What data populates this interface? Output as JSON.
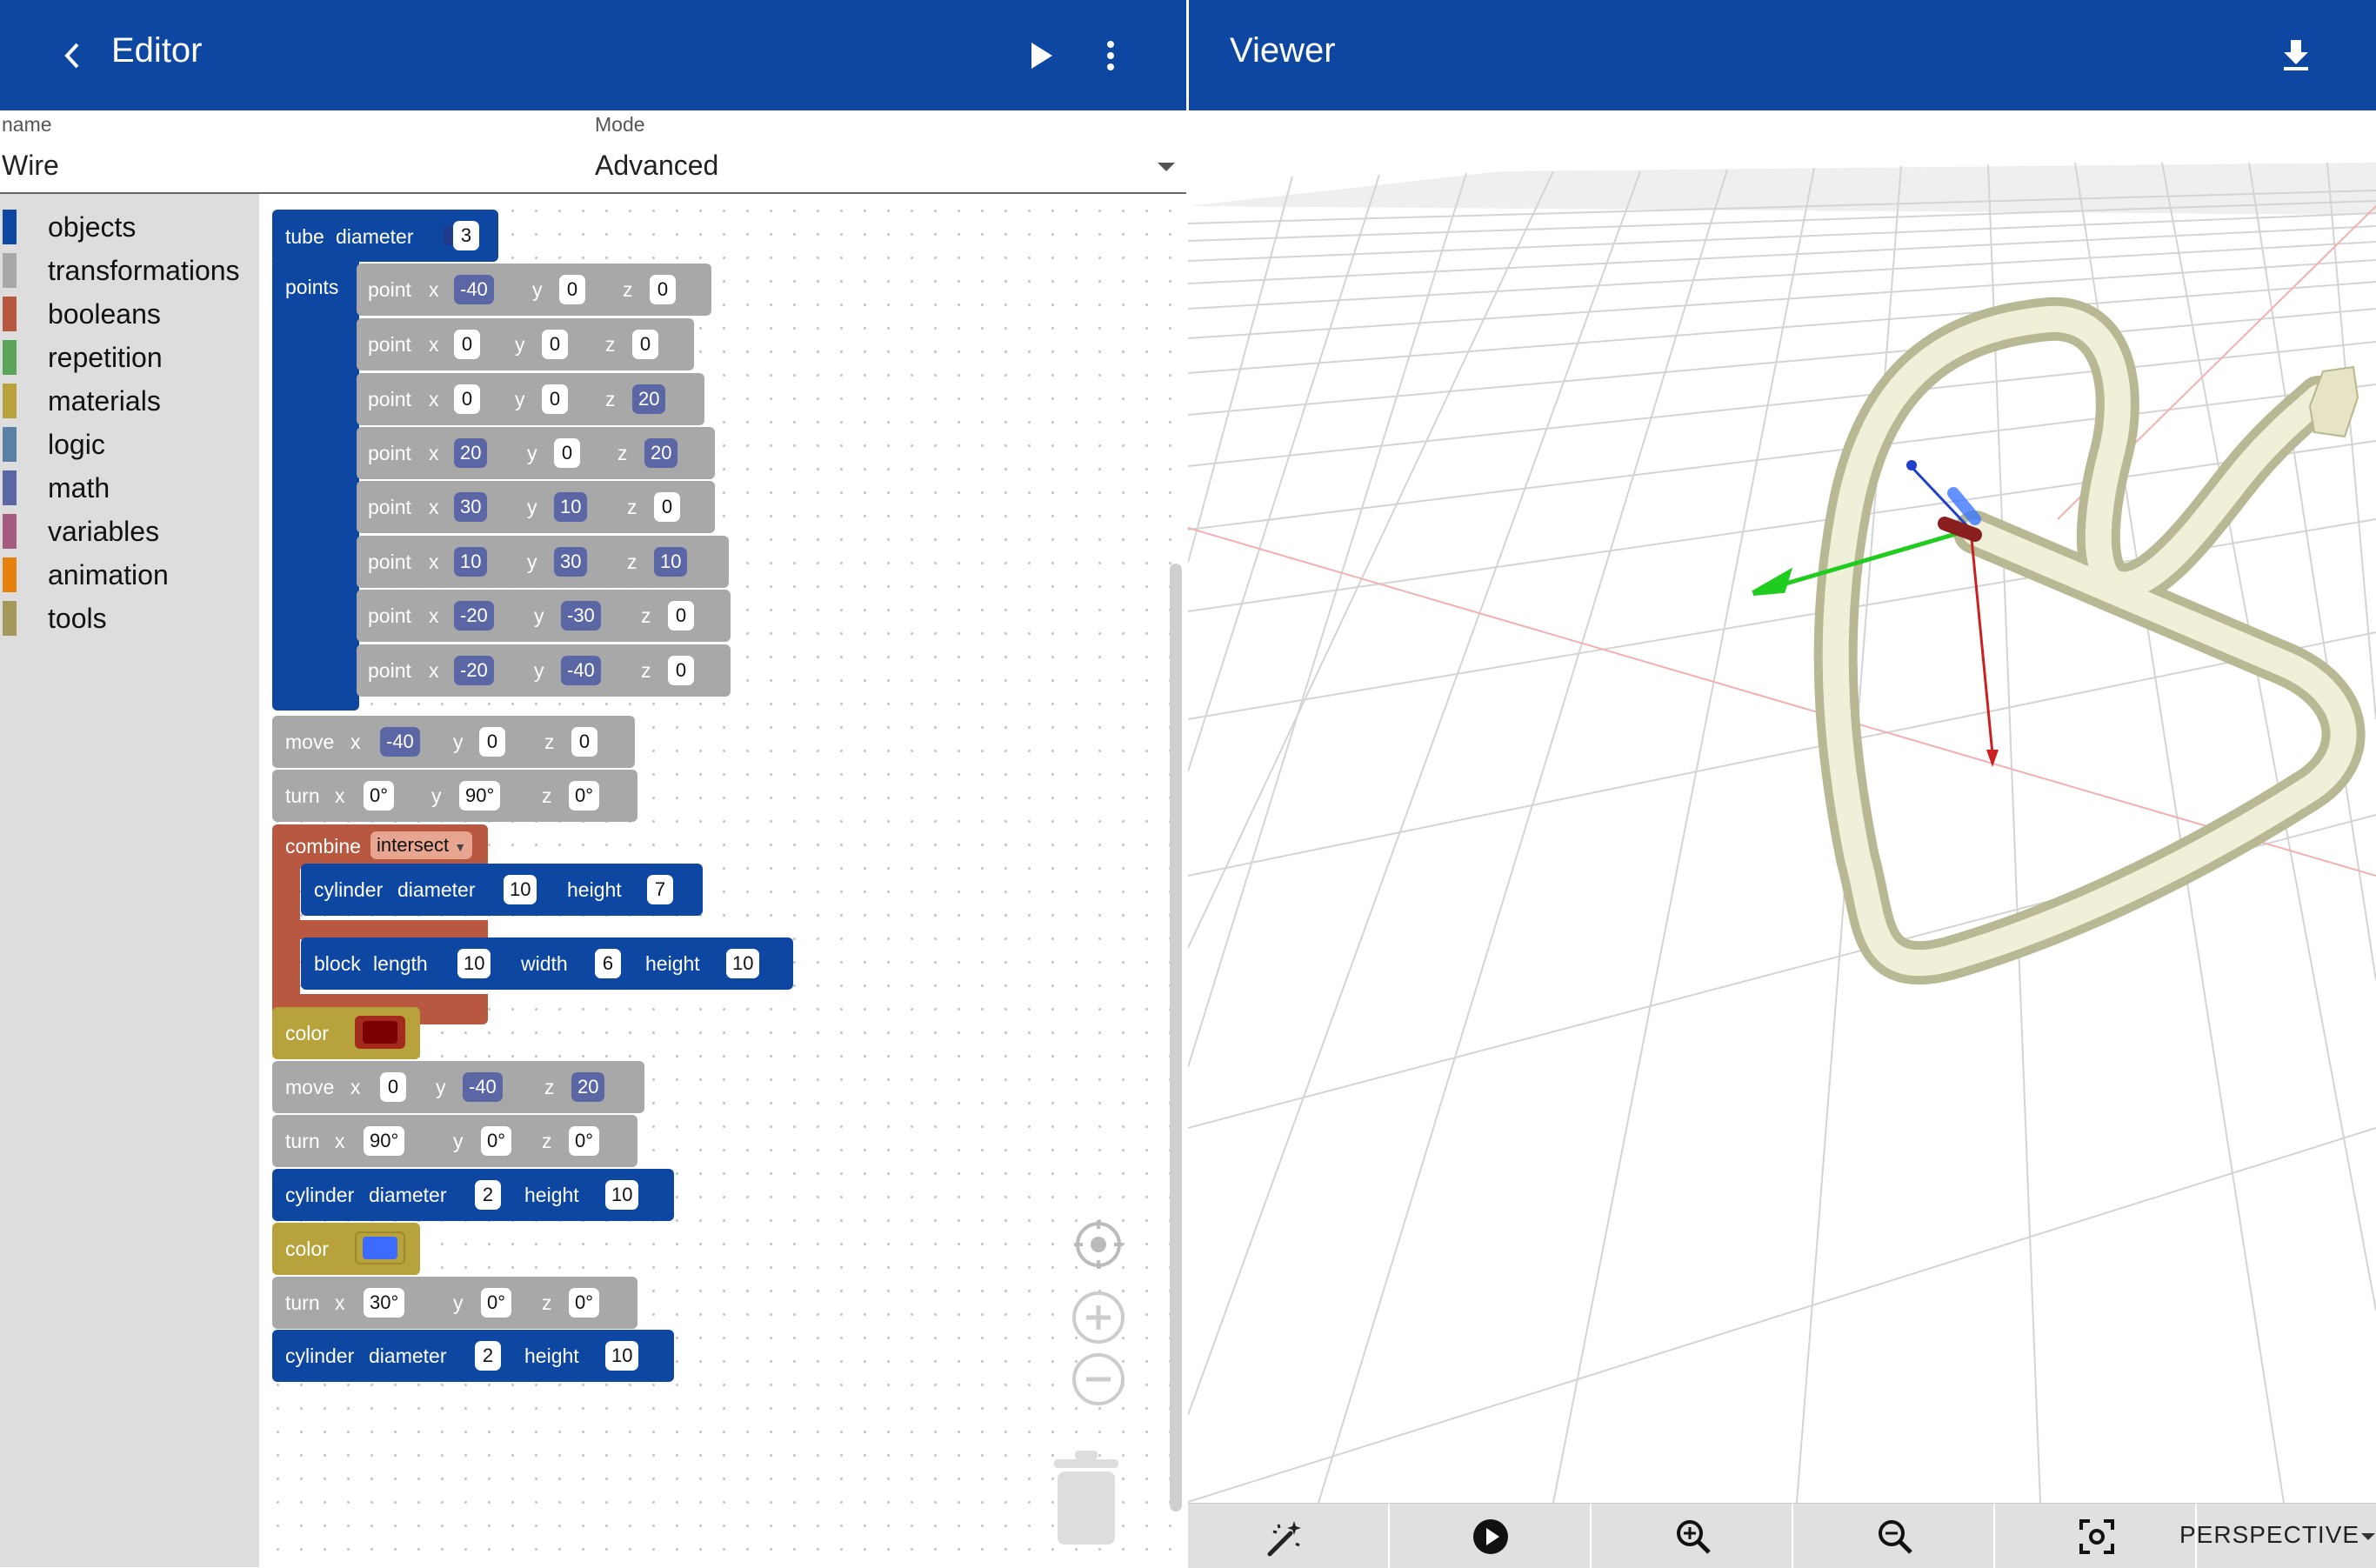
{
  "editor": {
    "title": "Editor",
    "name_label": "name",
    "name_value": "Wire",
    "mode_label": "Mode",
    "mode_value": "Advanced"
  },
  "viewer": {
    "title": "Viewer",
    "projection": "PERSPECTIVE"
  },
  "toolbox": [
    {
      "label": "objects",
      "color": "#0d47a1"
    },
    {
      "label": "transformations",
      "color": "#a8a8a8"
    },
    {
      "label": "booleans",
      "color": "#b85840"
    },
    {
      "label": "repetition",
      "color": "#5ba55b"
    },
    {
      "label": "materials",
      "color": "#b7a23b"
    },
    {
      "label": "logic",
      "color": "#5b80a5"
    },
    {
      "label": "math",
      "color": "#5b67a5"
    },
    {
      "label": "variables",
      "color": "#a55b80"
    },
    {
      "label": "animation",
      "color": "#e6810e"
    },
    {
      "label": "tools",
      "color": "#a5985b"
    }
  ],
  "kw": {
    "tube": "tube",
    "diameter": "diameter",
    "points": "points",
    "point": "point",
    "x": "x",
    "y": "y",
    "z": "z",
    "move": "move",
    "turn": "turn",
    "combine": "combine",
    "intersect": "intersect",
    "cylinder": "cylinder",
    "height": "height",
    "block": "block",
    "length": "length",
    "width": "width",
    "color": "color"
  },
  "blocks": {
    "tube_diameter": "3",
    "points": [
      [
        "-40",
        "0",
        "0"
      ],
      [
        "0",
        "0",
        "0"
      ],
      [
        "0",
        "0",
        "20"
      ],
      [
        "20",
        "0",
        "20"
      ],
      [
        "30",
        "10",
        "0"
      ],
      [
        "10",
        "30",
        "10"
      ],
      [
        "-20",
        "-30",
        "0"
      ],
      [
        "-20",
        "-40",
        "0"
      ]
    ],
    "move1": [
      "-40",
      "0",
      "0"
    ],
    "turn1": [
      "0°",
      "90°",
      "0°"
    ],
    "cyl1": [
      "10",
      "7"
    ],
    "block1": [
      "10",
      "6",
      "10"
    ],
    "color1": "#7a0000",
    "move2": [
      "0",
      "-40",
      "20"
    ],
    "turn2": [
      "90°",
      "0°",
      "0°"
    ],
    "cyl2": [
      "2",
      "10"
    ],
    "color2": "#3d6bff",
    "turn3": [
      "30°",
      "0°",
      "0°"
    ],
    "cyl3": [
      "2",
      "10"
    ]
  }
}
